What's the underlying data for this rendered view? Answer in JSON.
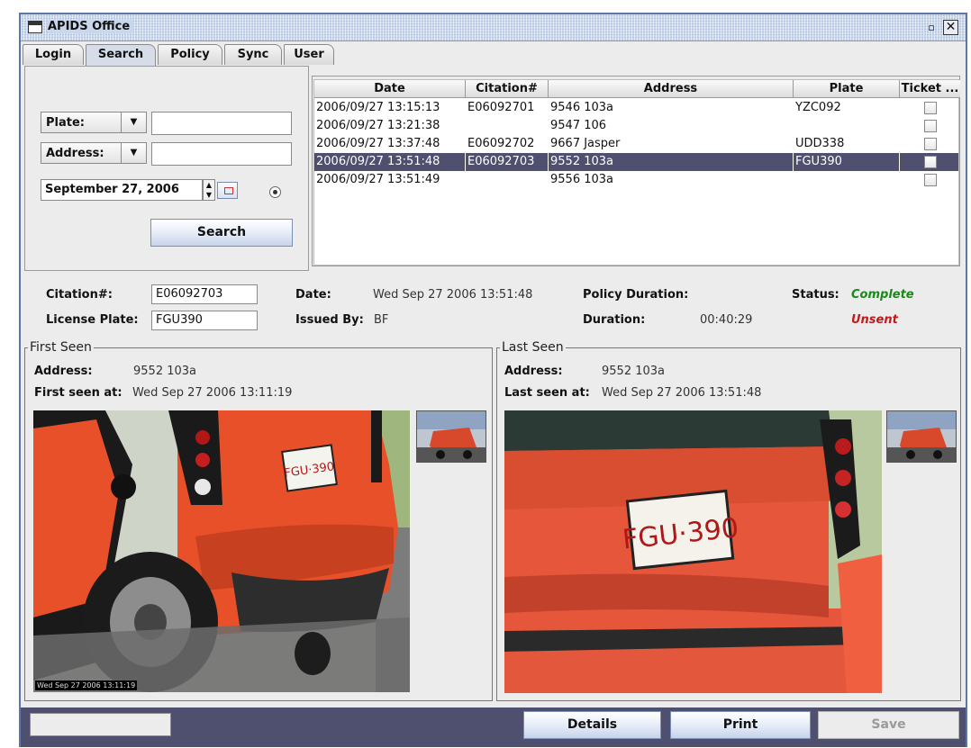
{
  "window": {
    "title": "APIDS Office",
    "restore_glyph": "▫",
    "close_glyph": "✕"
  },
  "tabs": [
    {
      "label": "Login",
      "active": false
    },
    {
      "label": "Search",
      "active": true
    },
    {
      "label": "Policy",
      "active": false
    },
    {
      "label": "Sync",
      "active": false
    },
    {
      "label": "User",
      "active": false
    }
  ],
  "search": {
    "plate_label": "Plate:",
    "plate_value": "",
    "address_label": "Address:",
    "address_value": "",
    "date_value": "September 27, 2006",
    "button_label": "Search"
  },
  "results_table": {
    "columns": [
      "Date",
      "Citation#",
      "Address",
      "Plate",
      "Ticket ..."
    ],
    "rows": [
      {
        "date": "2006/09/27 13:15:13",
        "citation": "E06092701",
        "address": "9546 103a",
        "plate": "YZC092",
        "ticket": false,
        "selected": false
      },
      {
        "date": "2006/09/27 13:21:38",
        "citation": "",
        "address": "9547 106",
        "plate": "",
        "ticket": false,
        "selected": false
      },
      {
        "date": "2006/09/27 13:37:48",
        "citation": "E06092702",
        "address": "9667 Jasper",
        "plate": "UDD338",
        "ticket": false,
        "selected": false
      },
      {
        "date": "2006/09/27 13:51:48",
        "citation": "E06092703",
        "address": "9552 103a",
        "plate": "FGU390",
        "ticket": false,
        "selected": true
      },
      {
        "date": "2006/09/27 13:51:49",
        "citation": "",
        "address": "9556 103a",
        "plate": "",
        "ticket": false,
        "selected": false
      }
    ]
  },
  "details": {
    "citation_label": "Citation#:",
    "citation_value": "E06092703",
    "license_label": "License Plate:",
    "license_value": "FGU390",
    "date_label": "Date:",
    "date_value": "Wed Sep 27 2006 13:51:48",
    "issued_label": "Issued By:",
    "issued_value": "BF",
    "policy_duration_label": "Policy Duration:",
    "policy_duration_value": "",
    "duration_label": "Duration:",
    "duration_value": "00:40:29",
    "status_label": "Status:",
    "status_value": "Complete",
    "send_status": "Unsent",
    "status_color": "#1a8a1a",
    "send_status_color": "#c21a1a"
  },
  "first_seen": {
    "legend": "First Seen",
    "address_label": "Address:",
    "address_value": "9552 103a",
    "time_label": "First seen at:",
    "time_value": "Wed Sep 27 2006 13:11:19",
    "photo_timestamp": "Wed Sep 27 2006 13:11:19",
    "plate_text": "FGU·390"
  },
  "last_seen": {
    "legend": "Last Seen",
    "address_label": "Address:",
    "address_value": "9552 103a",
    "time_label": "Last seen at:",
    "time_value": "Wed Sep 27 2006 13:51:48",
    "plate_text": "FGU·390"
  },
  "bottom": {
    "status_text": "",
    "details_label": "Details",
    "print_label": "Print",
    "save_label": "Save"
  },
  "colors": {
    "accent": "#4f4f70",
    "window_border": "#5e75a8",
    "car_red": "#e8502a"
  }
}
